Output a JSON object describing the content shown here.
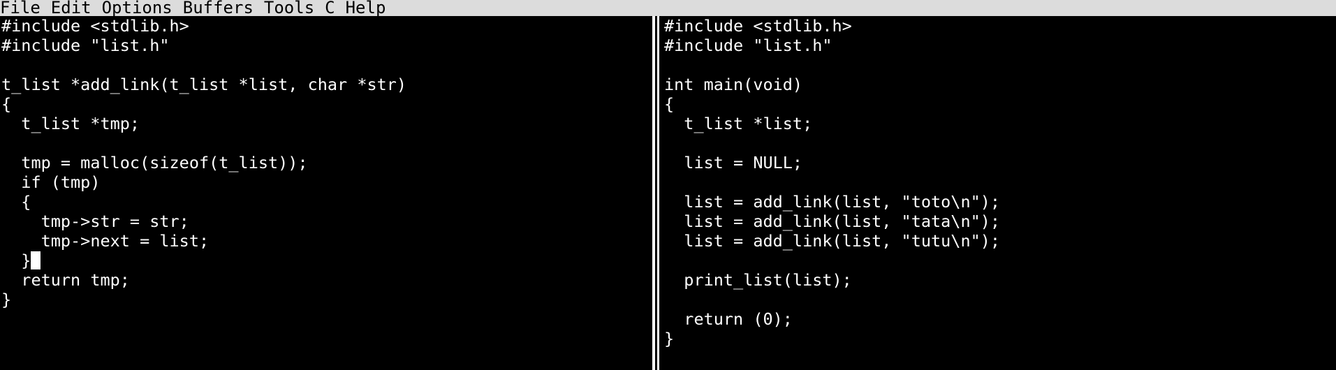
{
  "menubar": {
    "items": [
      "File",
      "Edit",
      "Options",
      "Buffers",
      "Tools",
      "C",
      "Help"
    ]
  },
  "left_buffer": {
    "lines": [
      "#include <stdlib.h>",
      "#include \"list.h\"",
      "",
      "t_list *add_link(t_list *list, char *str)",
      "{",
      "  t_list *tmp;",
      "",
      "  tmp = malloc(sizeof(t_list));",
      "  if (tmp)",
      "  {",
      "    tmp->str = str;",
      "    tmp->next = list;",
      "  }",
      "  return tmp;",
      "}"
    ]
  },
  "right_buffer": {
    "lines": [
      "#include <stdlib.h>",
      "#include \"list.h\"",
      "",
      "int main(void)",
      "{",
      "  t_list *list;",
      "",
      "  list = NULL;",
      "",
      "  list = add_link(list, \"toto\\n\");",
      "  list = add_link(list, \"tata\\n\");",
      "  list = add_link(list, \"tutu\\n\");",
      "",
      "  print_list(list);",
      "",
      "  return (0);",
      "}"
    ]
  },
  "colors": {
    "background": "#000000",
    "text": "#ffffff",
    "menubar_bg": "#dcdcdc"
  }
}
